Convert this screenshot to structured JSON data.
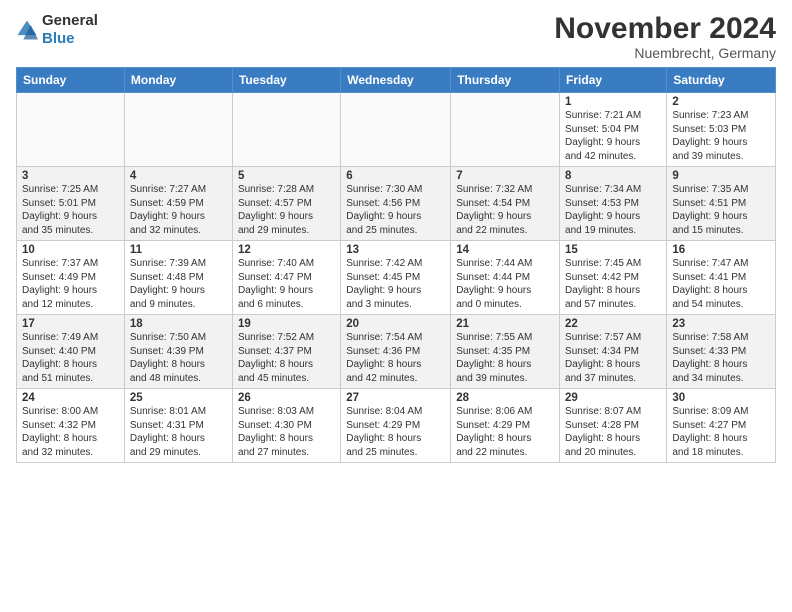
{
  "header": {
    "logo_general": "General",
    "logo_blue": "Blue",
    "month_title": "November 2024",
    "location": "Nuembrecht, Germany"
  },
  "weekdays": [
    "Sunday",
    "Monday",
    "Tuesday",
    "Wednesday",
    "Thursday",
    "Friday",
    "Saturday"
  ],
  "weeks": [
    [
      {
        "day": "",
        "info": ""
      },
      {
        "day": "",
        "info": ""
      },
      {
        "day": "",
        "info": ""
      },
      {
        "day": "",
        "info": ""
      },
      {
        "day": "",
        "info": ""
      },
      {
        "day": "1",
        "info": "Sunrise: 7:21 AM\nSunset: 5:04 PM\nDaylight: 9 hours\nand 42 minutes."
      },
      {
        "day": "2",
        "info": "Sunrise: 7:23 AM\nSunset: 5:03 PM\nDaylight: 9 hours\nand 39 minutes."
      }
    ],
    [
      {
        "day": "3",
        "info": "Sunrise: 7:25 AM\nSunset: 5:01 PM\nDaylight: 9 hours\nand 35 minutes."
      },
      {
        "day": "4",
        "info": "Sunrise: 7:27 AM\nSunset: 4:59 PM\nDaylight: 9 hours\nand 32 minutes."
      },
      {
        "day": "5",
        "info": "Sunrise: 7:28 AM\nSunset: 4:57 PM\nDaylight: 9 hours\nand 29 minutes."
      },
      {
        "day": "6",
        "info": "Sunrise: 7:30 AM\nSunset: 4:56 PM\nDaylight: 9 hours\nand 25 minutes."
      },
      {
        "day": "7",
        "info": "Sunrise: 7:32 AM\nSunset: 4:54 PM\nDaylight: 9 hours\nand 22 minutes."
      },
      {
        "day": "8",
        "info": "Sunrise: 7:34 AM\nSunset: 4:53 PM\nDaylight: 9 hours\nand 19 minutes."
      },
      {
        "day": "9",
        "info": "Sunrise: 7:35 AM\nSunset: 4:51 PM\nDaylight: 9 hours\nand 15 minutes."
      }
    ],
    [
      {
        "day": "10",
        "info": "Sunrise: 7:37 AM\nSunset: 4:49 PM\nDaylight: 9 hours\nand 12 minutes."
      },
      {
        "day": "11",
        "info": "Sunrise: 7:39 AM\nSunset: 4:48 PM\nDaylight: 9 hours\nand 9 minutes."
      },
      {
        "day": "12",
        "info": "Sunrise: 7:40 AM\nSunset: 4:47 PM\nDaylight: 9 hours\nand 6 minutes."
      },
      {
        "day": "13",
        "info": "Sunrise: 7:42 AM\nSunset: 4:45 PM\nDaylight: 9 hours\nand 3 minutes."
      },
      {
        "day": "14",
        "info": "Sunrise: 7:44 AM\nSunset: 4:44 PM\nDaylight: 9 hours\nand 0 minutes."
      },
      {
        "day": "15",
        "info": "Sunrise: 7:45 AM\nSunset: 4:42 PM\nDaylight: 8 hours\nand 57 minutes."
      },
      {
        "day": "16",
        "info": "Sunrise: 7:47 AM\nSunset: 4:41 PM\nDaylight: 8 hours\nand 54 minutes."
      }
    ],
    [
      {
        "day": "17",
        "info": "Sunrise: 7:49 AM\nSunset: 4:40 PM\nDaylight: 8 hours\nand 51 minutes."
      },
      {
        "day": "18",
        "info": "Sunrise: 7:50 AM\nSunset: 4:39 PM\nDaylight: 8 hours\nand 48 minutes."
      },
      {
        "day": "19",
        "info": "Sunrise: 7:52 AM\nSunset: 4:37 PM\nDaylight: 8 hours\nand 45 minutes."
      },
      {
        "day": "20",
        "info": "Sunrise: 7:54 AM\nSunset: 4:36 PM\nDaylight: 8 hours\nand 42 minutes."
      },
      {
        "day": "21",
        "info": "Sunrise: 7:55 AM\nSunset: 4:35 PM\nDaylight: 8 hours\nand 39 minutes."
      },
      {
        "day": "22",
        "info": "Sunrise: 7:57 AM\nSunset: 4:34 PM\nDaylight: 8 hours\nand 37 minutes."
      },
      {
        "day": "23",
        "info": "Sunrise: 7:58 AM\nSunset: 4:33 PM\nDaylight: 8 hours\nand 34 minutes."
      }
    ],
    [
      {
        "day": "24",
        "info": "Sunrise: 8:00 AM\nSunset: 4:32 PM\nDaylight: 8 hours\nand 32 minutes."
      },
      {
        "day": "25",
        "info": "Sunrise: 8:01 AM\nSunset: 4:31 PM\nDaylight: 8 hours\nand 29 minutes."
      },
      {
        "day": "26",
        "info": "Sunrise: 8:03 AM\nSunset: 4:30 PM\nDaylight: 8 hours\nand 27 minutes."
      },
      {
        "day": "27",
        "info": "Sunrise: 8:04 AM\nSunset: 4:29 PM\nDaylight: 8 hours\nand 25 minutes."
      },
      {
        "day": "28",
        "info": "Sunrise: 8:06 AM\nSunset: 4:29 PM\nDaylight: 8 hours\nand 22 minutes."
      },
      {
        "day": "29",
        "info": "Sunrise: 8:07 AM\nSunset: 4:28 PM\nDaylight: 8 hours\nand 20 minutes."
      },
      {
        "day": "30",
        "info": "Sunrise: 8:09 AM\nSunset: 4:27 PM\nDaylight: 8 hours\nand 18 minutes."
      }
    ]
  ]
}
